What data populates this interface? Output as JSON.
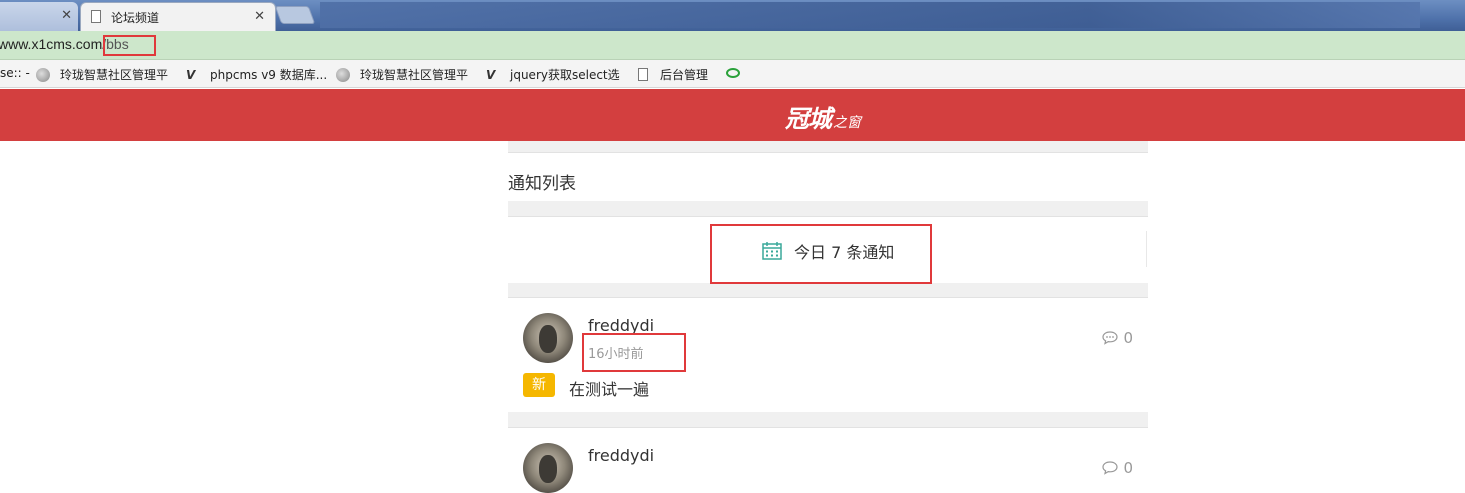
{
  "browser": {
    "tabs": [
      {
        "title": ""
      },
      {
        "title": "论坛频道"
      }
    ],
    "url": {
      "host": "www.x1cms.com",
      "path": "/bbs"
    },
    "bookmarks": [
      {
        "label": "se:: -"
      },
      {
        "label": "玲珑智慧社区管理平"
      },
      {
        "label": "phpcms v9 数据库..."
      },
      {
        "label": "玲珑智慧社区管理平"
      },
      {
        "label": "jquery获取select选"
      },
      {
        "label": "后台管理"
      }
    ]
  },
  "site": {
    "logo": {
      "main": "冠城",
      "sub": "之窗"
    },
    "section_title": "通知列表",
    "summary": "今日 7 条通知",
    "posts": [
      {
        "author": "freddydi",
        "time": "16小时前",
        "comments": "0",
        "badge": "新",
        "text": "在测试一遍"
      },
      {
        "author": "freddydi",
        "comments": "0"
      }
    ]
  },
  "colors": {
    "header": "#d33f3f",
    "badge": "#f5b700",
    "annotation": "#e0393b",
    "icon_teal": "#3aa89a"
  }
}
